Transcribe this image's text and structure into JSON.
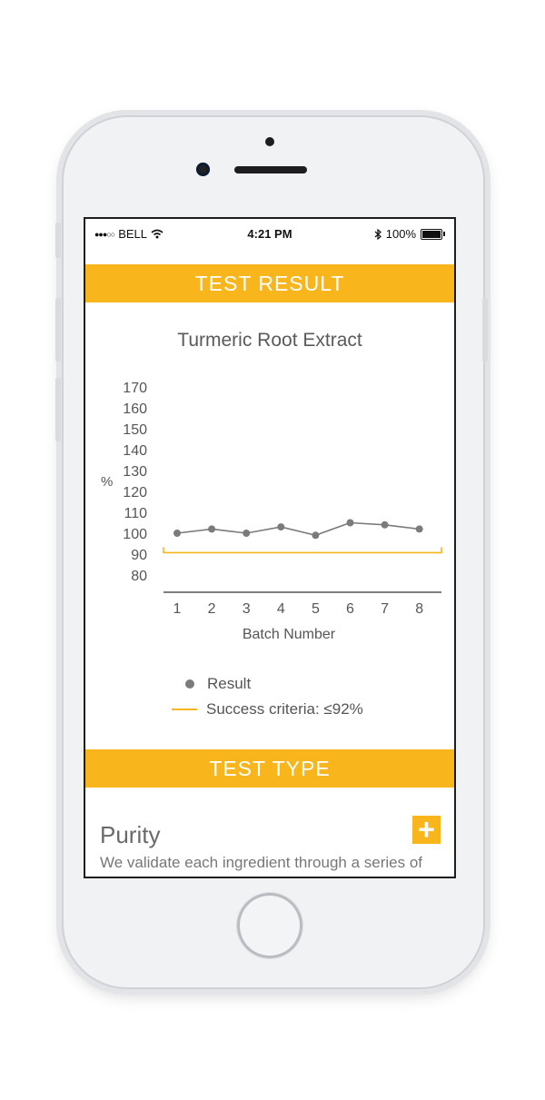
{
  "status_bar": {
    "carrier": "BELL",
    "time": "4:21 PM",
    "battery": "100%"
  },
  "header": {
    "title": "TEST RESULT"
  },
  "chart_data": {
    "type": "line",
    "title": "Turmeric Root Extract",
    "xlabel": "Batch Number",
    "ylabel": "%",
    "x": [
      1,
      2,
      3,
      4,
      5,
      6,
      7,
      8
    ],
    "yticks": [
      80,
      90,
      100,
      110,
      120,
      130,
      140,
      150,
      160,
      170
    ],
    "ylim": [
      75,
      172
    ],
    "series": [
      {
        "name": "Result",
        "values": [
          100,
          102,
          100,
          103,
          99,
          105,
          104,
          102
        ],
        "color": "#7b7b7b"
      }
    ],
    "threshold": {
      "label": "Success criteria: ≤92%",
      "value": 92,
      "color": "#f8b51c"
    }
  },
  "section2": {
    "title": "TEST TYPE"
  },
  "purity": {
    "title": "Purity",
    "description": "We validate each ingredient through a series of",
    "expand_label": "+"
  },
  "colors": {
    "accent": "#f8b51c"
  }
}
